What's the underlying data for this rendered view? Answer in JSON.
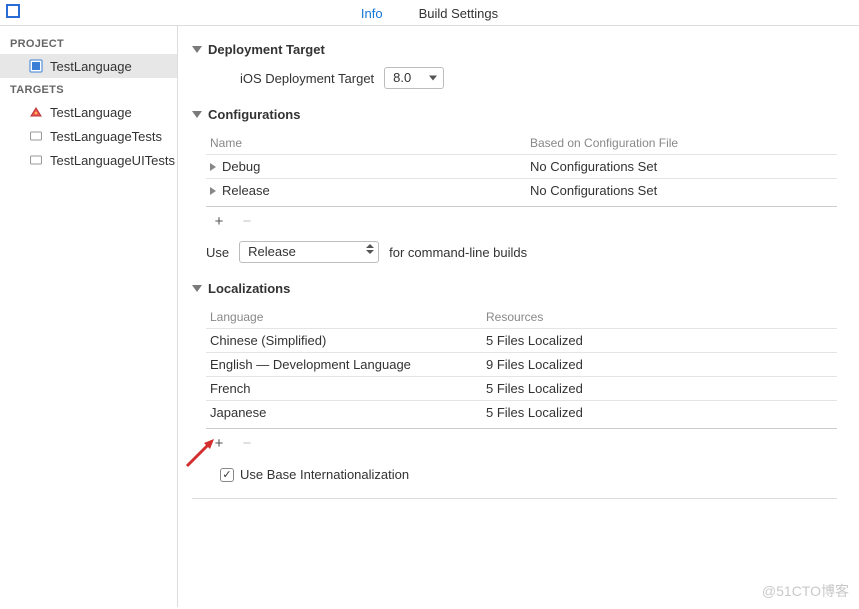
{
  "tabs": {
    "info": "Info",
    "build": "Build Settings"
  },
  "sidebar": {
    "project_header": "PROJECT",
    "project_item": "TestLanguage",
    "targets_header": "TARGETS",
    "targets": [
      {
        "label": "TestLanguage",
        "icon": "app-icon"
      },
      {
        "label": "TestLanguageTests",
        "icon": "bundle-icon"
      },
      {
        "label": "TestLanguageUITests",
        "icon": "bundle-icon"
      }
    ]
  },
  "deployment": {
    "title": "Deployment Target",
    "field_label": "iOS Deployment Target",
    "value": "8.0"
  },
  "configurations": {
    "title": "Configurations",
    "col_name": "Name",
    "col_based": "Based on Configuration File",
    "rows": [
      {
        "name": "Debug",
        "based": "No Configurations Set"
      },
      {
        "name": "Release",
        "based": "No Configurations Set"
      }
    ],
    "use_label": "Use",
    "use_value": "Release",
    "use_suffix": "for command-line builds"
  },
  "localizations": {
    "title": "Localizations",
    "col_lang": "Language",
    "col_res": "Resources",
    "rows": [
      {
        "lang": "Chinese (Simplified)",
        "res": "5 Files Localized"
      },
      {
        "lang": "English — Development Language",
        "res": "9 Files Localized"
      },
      {
        "lang": "French",
        "res": "5 Files Localized"
      },
      {
        "lang": "Japanese",
        "res": "5 Files Localized"
      }
    ],
    "base_label": "Use Base Internationalization"
  },
  "watermark": "@51CTO博客"
}
